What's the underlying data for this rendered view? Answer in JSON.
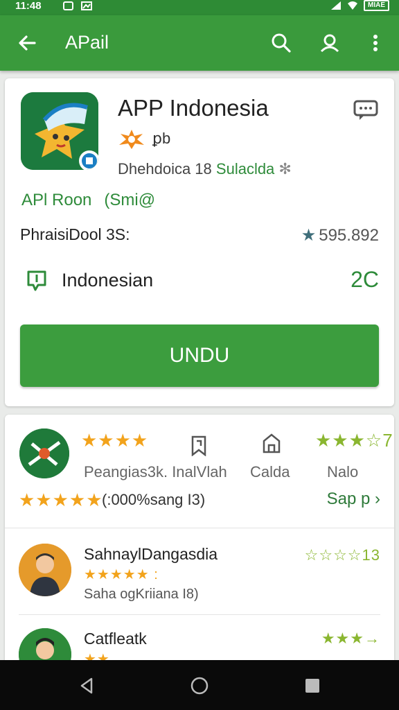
{
  "status_bar": {
    "time": "11:48",
    "battery": "MIAE"
  },
  "app_bar": {
    "title": "APail"
  },
  "app": {
    "name": "APP Indonesia",
    "tag": "ꝑb",
    "developer_prefix": "Dhehdoica 18",
    "developer_link": "Sulaclda",
    "category": "APl Roon",
    "category_sub": "(Smi@",
    "stat_label": "PhraisiDool 3S:",
    "stat_value": "595.892",
    "language_label": "Indonesian",
    "language_value": "2C",
    "install_label": "UNDU"
  },
  "ratings": {
    "top_stars": "★★★★",
    "right_stars": "★★★☆7",
    "label_1": "Peangias3k. InalVlah",
    "label_2": "Calda",
    "label_3": "Nalo",
    "summary_stars": "★★★★★",
    "summary_text": "(:000%sang I3)",
    "more_label": "Sap p ›"
  },
  "reviews": [
    {
      "name": "SahnaylDangasdia",
      "stars": "★★★★★ :",
      "sub": "Saha ogKriiana I8)",
      "right": "☆☆☆☆13"
    },
    {
      "name": "Catfleatk",
      "stars": "★★",
      "sub": "",
      "right": "★★★→"
    }
  ],
  "colors": {
    "primary": "#3a9a3c",
    "accent_green": "#2e8b3a",
    "star_orange": "#f2a31c",
    "star_green": "#8ab630"
  }
}
